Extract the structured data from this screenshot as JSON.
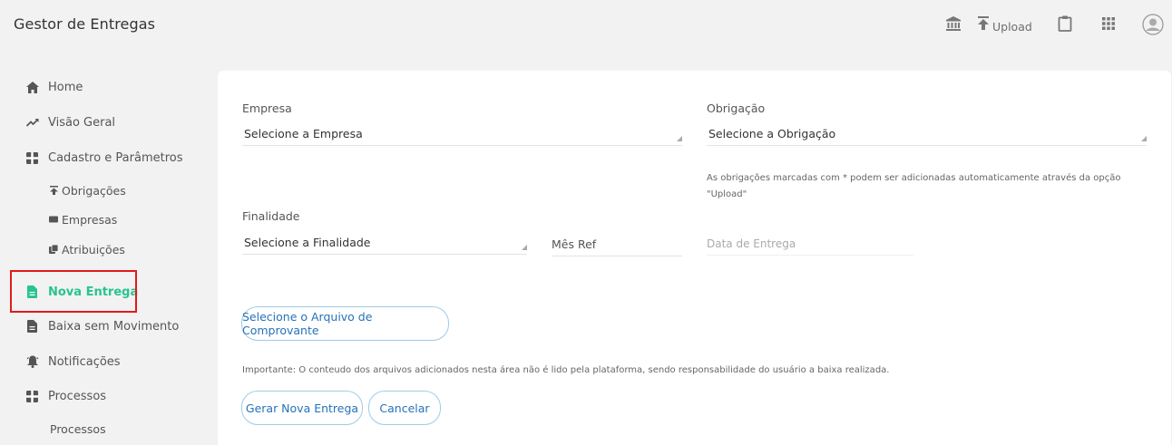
{
  "app": {
    "title": "Gestor de Entregas"
  },
  "topbar": {
    "icons": [
      "bank-icon",
      "upload-icon",
      "clipboard-icon",
      "apps-grid-icon",
      "account-icon"
    ],
    "upload_label": "Upload"
  },
  "sidebar": {
    "items": [
      {
        "label": "Home",
        "icon": "home-icon"
      },
      {
        "label": "Visão Geral",
        "icon": "trending-up-icon"
      },
      {
        "label": "Cadastro e Parâmetros",
        "icon": "settings-box-icon"
      },
      {
        "label": "Obrigações",
        "icon": "upload-icon",
        "sub": true
      },
      {
        "label": "Empresas",
        "icon": "card-icon",
        "sub": true
      },
      {
        "label": "Atribuições",
        "icon": "copy-icon",
        "sub": true
      },
      {
        "label": "Nova Entrega",
        "icon": "document-icon",
        "active": true
      },
      {
        "label": "Baixa sem Movimento",
        "icon": "document-icon"
      },
      {
        "label": "Notificações",
        "icon": "bell-icon"
      },
      {
        "label": "Processos",
        "icon": "settings-box-icon"
      },
      {
        "label": "Processos",
        "sub": true
      }
    ]
  },
  "form": {
    "empresa": {
      "label": "Empresa",
      "value": "Selecione a Empresa"
    },
    "obrigacao": {
      "label": "Obrigação",
      "value": "Selecione a Obrigação",
      "help_line1": "As obrigações marcadas com * podem ser adicionadas automaticamente através da opção",
      "help_line2": "\"Upload\""
    },
    "finalidade": {
      "label": "Finalidade",
      "value": "Selecione a Finalidade"
    },
    "mes_ref": {
      "placeholder": "Mês Ref"
    },
    "data_entrega": {
      "placeholder": "Data de Entrega"
    },
    "file_button": "Selecione o Arquivo de Comprovante",
    "note": "Importante: O conteudo dos arquivos adicionados nesta área não é lido pela plataforma, sendo responsabilidade do usuário a baixa realizada.",
    "submit": "Gerar Nova Entrega",
    "cancel": "Cancelar"
  },
  "colors": {
    "accent": "#27c48f",
    "link": "#2572b9",
    "highlight": "#e01a1a",
    "background": "#f2f2f2"
  }
}
